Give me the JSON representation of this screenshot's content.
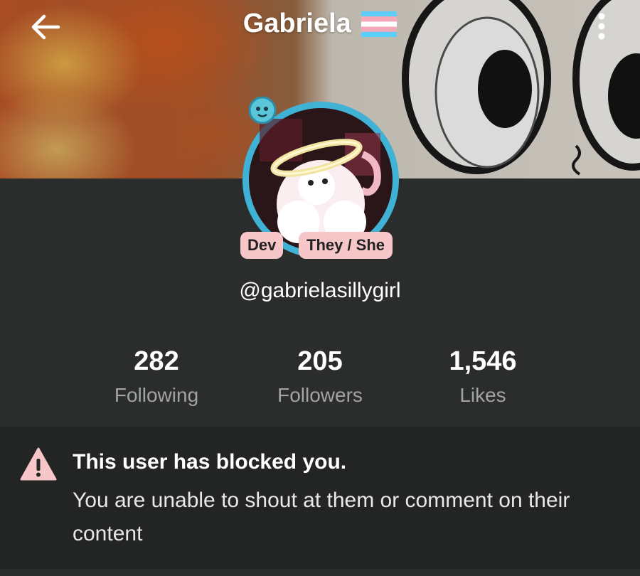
{
  "header": {
    "title": "Gabriela",
    "flag_icon": "trans-flag-icon",
    "back_icon": "back-arrow-icon",
    "more_icon": "more-vertical-icon",
    "flag_colors": [
      "#5bcefa",
      "#f5a9b8",
      "#ffffff",
      "#f5a9b8",
      "#5bcefa"
    ]
  },
  "profile": {
    "badges": [
      "Dev",
      "They / She"
    ],
    "username": "@gabrielasillygirl",
    "avatar_ring_color": "#3fb2d6"
  },
  "stats": [
    {
      "value": "282",
      "label": "Following"
    },
    {
      "value": "205",
      "label": "Followers"
    },
    {
      "value": "1,546",
      "label": "Likes"
    }
  ],
  "notice": {
    "icon": "warning-icon",
    "title": "This user has blocked you.",
    "body": "You are unable to shout at them or comment on their content",
    "icon_color": "#f6c6c9"
  }
}
